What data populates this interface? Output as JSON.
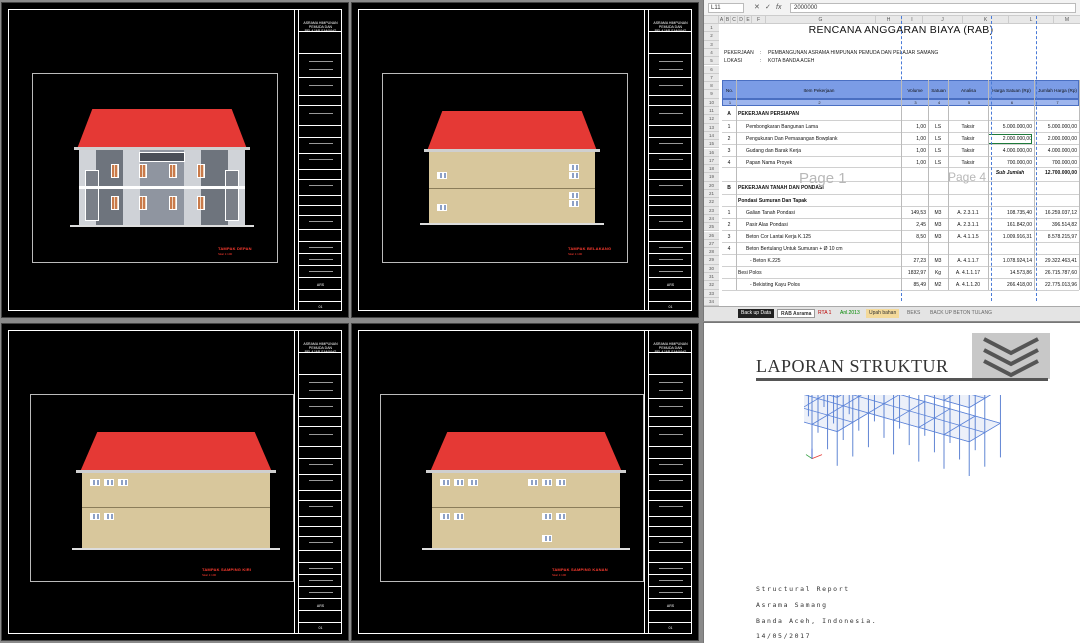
{
  "cad_views": [
    {
      "id": "view-1",
      "title": "TAMPAK DEPAN",
      "scale": "Skal 1:100",
      "type": "front"
    },
    {
      "id": "view-2",
      "title": "TAMPAK BELAKANG",
      "scale": "Skal 1:100",
      "type": "side"
    },
    {
      "id": "view-3",
      "title": "TAMPAK SAMPING KIRI",
      "scale": "Skal 1:100",
      "type": "side2"
    },
    {
      "id": "view-4",
      "title": "TAMPAK SAMPING KANAN",
      "scale": "Skal 1:100",
      "type": "side3"
    }
  ],
  "titleblock": {
    "project": "ASRAMA HIMPUNAN PEMUDA DAN PELAJAR SAMANG",
    "sheet_no": "01",
    "code": "ARS"
  },
  "colors": {
    "roof": "#e53935",
    "wall": "#d8c79c",
    "header": "#7b9ce6",
    "cad_bg": "#000000"
  },
  "excel": {
    "namebox": "L11",
    "formula": "2000000",
    "column_headers": [
      "A",
      "B",
      "C",
      "D",
      "E",
      "F",
      "G",
      "H",
      "I",
      "J",
      "K",
      "L",
      "M"
    ],
    "title": "RENCANA ANGGARAN BIAYA (RAB)",
    "pekerjaan_label": "PEKERJAAN",
    "pekerjaan_value": "PEMBANGUNAN ASRAMA HIMPUNAN PEMUDA DAN PELAJAR SAMANG",
    "lokasi_label": "LOKASI",
    "lokasi_value": "KOTA BANDA ACEH",
    "headers": [
      "No.",
      "Item Pekerjaan",
      "Volume",
      "Satuan",
      "Analisa",
      "Harga Satuan (Rp)",
      "Jumlah Harga (Rp)"
    ],
    "header_numbers": [
      "1",
      "2",
      "3",
      "4",
      "5",
      "6",
      "7"
    ],
    "rows": [
      {
        "no": "A",
        "item": "PEKERJAAN PERSIAPAN",
        "vol": "",
        "sat": "",
        "ana": "",
        "harga": "",
        "jumlah": "",
        "bold": true
      },
      {
        "no": "1",
        "item": "Pembongkaran Bangunan Lama",
        "vol": "1,00",
        "sat": "LS",
        "ana": "Taksir",
        "harga": "5.000.000,00",
        "jumlah": "5.000.000,00"
      },
      {
        "no": "2",
        "item": "Pengukuran Dan Pemasangan Bowplank",
        "vol": "1,00",
        "sat": "LS",
        "ana": "Taksir",
        "harga": "2.000.000,00",
        "jumlah": "2.000.000,00",
        "selected": true
      },
      {
        "no": "3",
        "item": "Gudang dan Barak Kerja",
        "vol": "1,00",
        "sat": "LS",
        "ana": "Taksir",
        "harga": "4.000.000,00",
        "jumlah": "4.000.000,00"
      },
      {
        "no": "4",
        "item": "Papan Nama Proyek",
        "vol": "1,00",
        "sat": "LS",
        "ana": "Taksir",
        "harga": "700.000,00",
        "jumlah": "700.000,00"
      },
      {
        "no": "",
        "item": "",
        "vol": "",
        "sat": "",
        "ana": "",
        "harga": "Sub Jumlah",
        "jumlah": "12.700.000,00",
        "bold": true
      },
      {
        "no": "B",
        "item": "PEKERJAAN TANAH DAN PONDASI",
        "vol": "",
        "sat": "",
        "ana": "",
        "harga": "",
        "jumlah": "",
        "bold": true
      },
      {
        "no": "",
        "item": "Pondasi Sumuran Dan Tapak",
        "vol": "",
        "sat": "",
        "ana": "",
        "harga": "",
        "jumlah": "",
        "bold": true
      },
      {
        "no": "1",
        "item": "Galian Tanah Pondasi",
        "vol": "149,53",
        "sat": "M3",
        "ana": "A. 2.3.1.1",
        "harga": "108.735,40",
        "jumlah": "16.259.037,12"
      },
      {
        "no": "2",
        "item": "Pasir Alas Pondasi",
        "vol": "2,45",
        "sat": "M3",
        "ana": "A. 2.3.1.1",
        "harga": "161.842,00",
        "jumlah": "396.514,82"
      },
      {
        "no": "3",
        "item": "Beton Cor Lantai Kerja K.125",
        "vol": "8,50",
        "sat": "M3",
        "ana": "A. 4.1.1.5",
        "harga": "1.009.916,31",
        "jumlah": "8.578.215,97"
      },
      {
        "no": "4",
        "item": "Beton Bertulang Untuk Sumuran + Ø 10 cm",
        "vol": "",
        "sat": "",
        "ana": "",
        "harga": "",
        "jumlah": ""
      },
      {
        "no": "",
        "item": "- Beton K.225",
        "vol": "27,23",
        "sat": "M3",
        "ana": "A. 4.1.1.7",
        "harga": "1.078.924,14",
        "jumlah": "29.322.463,41"
      },
      {
        "no": "",
        "item": "Besi Polos",
        "vol": "1832,97",
        "sat": "Kg",
        "ana": "A. 4.1.1.17",
        "harga": "14.573,86",
        "jumlah": "26.715.787,60"
      },
      {
        "no": "",
        "item": "- Bekisting Kayu Polos",
        "vol": "85,49",
        "sat": "M2",
        "ana": "A. 4.1.1.20",
        "harga": "266.418,00",
        "jumlah": "22.775.013,96"
      }
    ],
    "page_marks": [
      "Page 1",
      "Page 4"
    ],
    "sheet_tabs": [
      "Back up Data",
      "RAB Asrama",
      "RTA 1",
      "Anl.2013",
      "Upah bahan",
      "BEKS",
      "BACK UP BETON TULANG"
    ]
  },
  "report": {
    "title": "LAPORAN STRUKTUR",
    "line1": "Structural Report",
    "line2": "Asrama Samang",
    "line3": "Banda Aceh, Indonesia.",
    "line4": "14/05/2017"
  }
}
